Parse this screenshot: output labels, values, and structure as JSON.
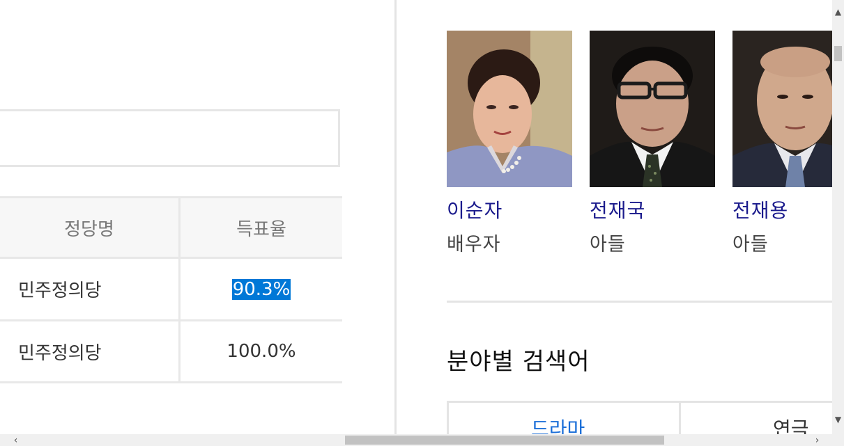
{
  "election_table": {
    "headers": [
      "정당명",
      "득표율"
    ],
    "rows": [
      {
        "party": "민주정의당",
        "rate": "90.3%",
        "selected": true
      },
      {
        "party": "민주정의당",
        "rate": "100.0%",
        "selected": false
      }
    ]
  },
  "family": [
    {
      "name": "이순자",
      "relation": "배우자"
    },
    {
      "name": "전재국",
      "relation": "아들"
    },
    {
      "name": "전재용",
      "relation": "아들"
    }
  ],
  "category_section": {
    "title": "분야별 검색어",
    "tabs": [
      "드라마",
      "연극"
    ]
  },
  "colors": {
    "name_link": "#1a1a8c",
    "selection": "#0078d7",
    "active_tab": "#1a6ed8"
  },
  "icons": {
    "scroll_up": "▲",
    "scroll_down": "▼",
    "scroll_left": "‹",
    "scroll_right": "›"
  }
}
